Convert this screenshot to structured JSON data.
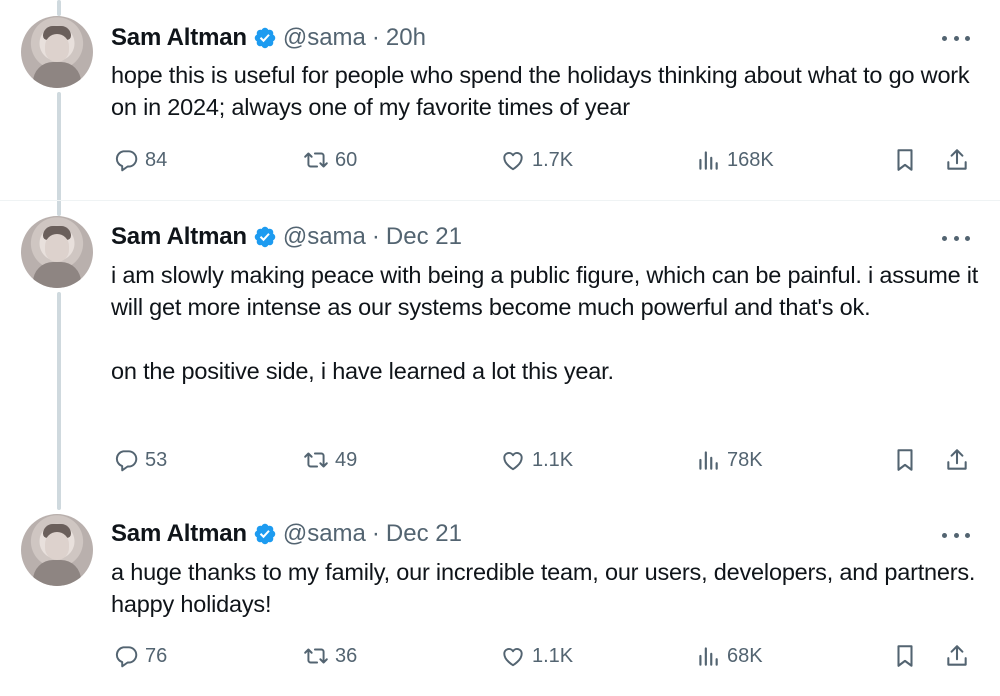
{
  "tweets": [
    {
      "author": "Sam Altman",
      "handle": "@sama",
      "separator": "·",
      "time": "20h",
      "paragraphs": [
        "hope this is useful for people who spend the holidays thinking about what to go work on in 2024; always one of my favorite times of year"
      ],
      "replies": "84",
      "retweets": "60",
      "likes": "1.7K",
      "views": "168K"
    },
    {
      "author": "Sam Altman",
      "handle": "@sama",
      "separator": "·",
      "time": "Dec 21",
      "paragraphs": [
        "i am slowly making peace with being a public figure, which can be painful. i assume it will get more intense as our systems become much powerful and that's ok.",
        "on the positive side, i have learned a lot this year."
      ],
      "replies": "53",
      "retweets": "49",
      "likes": "1.1K",
      "views": "78K"
    },
    {
      "author": "Sam Altman",
      "handle": "@sama",
      "separator": "·",
      "time": "Dec 21",
      "paragraphs": [
        "a huge thanks to my family, our incredible team, our users, developers, and partners. happy holidays!"
      ],
      "replies": "76",
      "retweets": "36",
      "likes": "1.1K",
      "views": "68K"
    }
  ],
  "icons": {
    "verified": "verified-badge-icon",
    "more": "more-options-icon",
    "reply": "reply-icon",
    "retweet": "retweet-icon",
    "like": "like-icon",
    "views": "views-icon",
    "bookmark": "bookmark-icon",
    "share": "share-icon"
  },
  "colors": {
    "verified": "#1d9bf0",
    "muted": "#536471",
    "text": "#0f1419",
    "thread_line": "#cfd9de"
  }
}
